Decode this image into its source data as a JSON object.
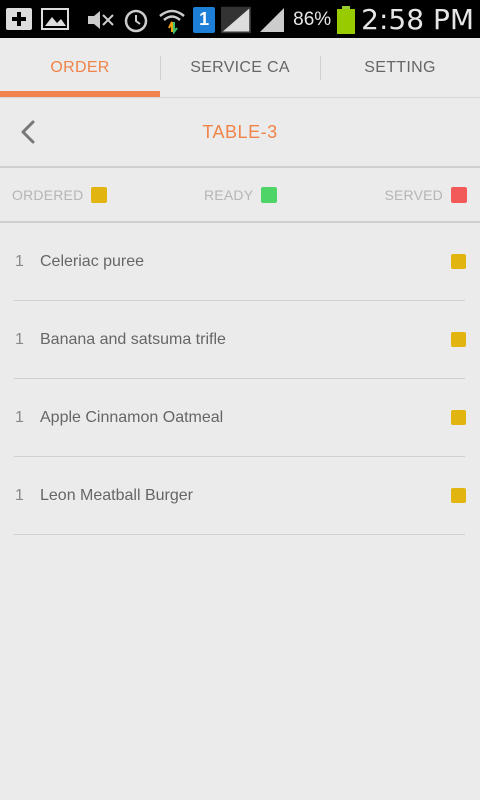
{
  "statusbar": {
    "battery_percent": "86%",
    "time": "2:58 PM",
    "sim_slot": "1",
    "icons": [
      "add-notification-icon",
      "image-notification-icon",
      "mute-icon",
      "alarm-icon",
      "wifi-icon",
      "sim-icon",
      "signal-icon",
      "signal-icon-2",
      "battery-icon"
    ]
  },
  "tabs": [
    {
      "label": "ORDER",
      "active": true
    },
    {
      "label": "SERVICE CA",
      "active": false
    },
    {
      "label": "SETTING",
      "active": false
    }
  ],
  "header": {
    "title": "TABLE-3",
    "back_icon": "chevron-left-icon"
  },
  "legend": [
    {
      "label": "ORDERED",
      "color": "#e2b410"
    },
    {
      "label": "READY",
      "color": "#4fd467"
    },
    {
      "label": "SERVED",
      "color": "#f25a5a"
    }
  ],
  "orders": [
    {
      "qty": "1",
      "name": "Celeriac puree",
      "status_color": "#e2b410"
    },
    {
      "qty": "1",
      "name": "Banana and satsuma trifle",
      "status_color": "#e2b410"
    },
    {
      "qty": "1",
      "name": "Apple Cinnamon Oatmeal",
      "status_color": "#e2b410"
    },
    {
      "qty": "1",
      "name": "Leon Meatball Burger",
      "status_color": "#e2b410"
    }
  ],
  "colors": {
    "accent": "#f0844a",
    "background": "#ebebeb"
  }
}
